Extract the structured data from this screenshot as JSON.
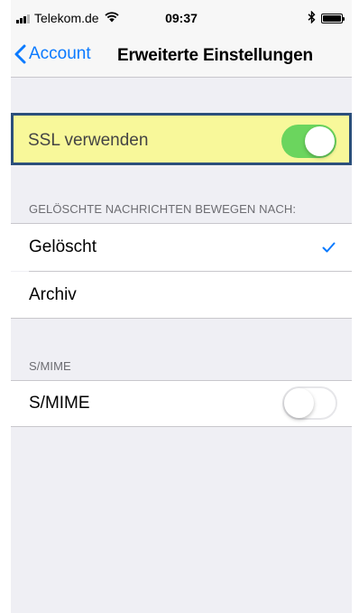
{
  "status_bar": {
    "carrier": "Telekom.de",
    "time": "09:37",
    "icons": [
      "signal-icon",
      "wifi-icon",
      "bluetooth-icon",
      "battery-icon"
    ]
  },
  "nav": {
    "back_label": "Account",
    "title": "Erweiterte Einstellungen"
  },
  "ssl": {
    "label": "SSL verwenden",
    "enabled": true,
    "highlight_color": "#f8f89a",
    "toggle_on_color": "#6bd55e"
  },
  "deleted_section": {
    "header": "GELÖSCHTE NACHRICHTEN BEWEGEN NACH:",
    "options": [
      {
        "label": "Gelöscht",
        "selected": true
      },
      {
        "label": "Archiv",
        "selected": false
      }
    ]
  },
  "smime_section": {
    "header": "S/MIME",
    "label": "S/MIME",
    "enabled": false
  },
  "accent_color": "#0a7aff"
}
